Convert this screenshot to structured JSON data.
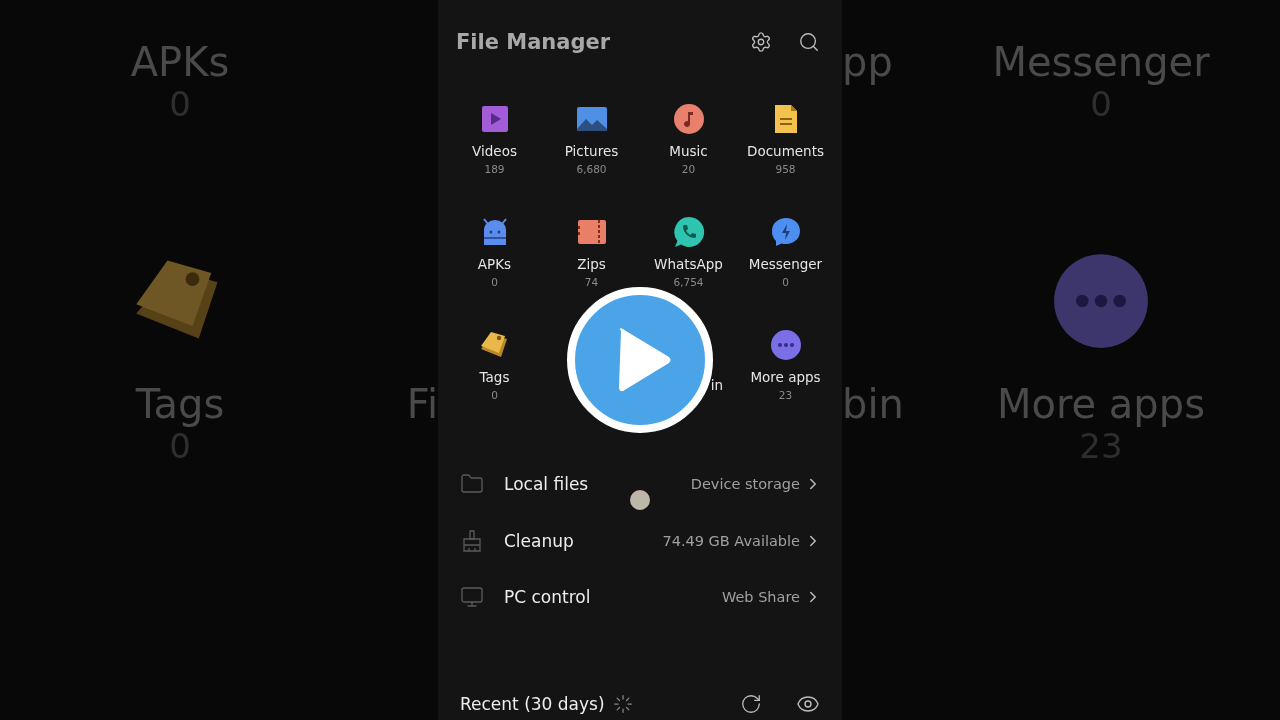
{
  "backdrop": {
    "left": {
      "column": [
        {
          "label": "APKs",
          "count": "0"
        },
        {
          "label": "Tags",
          "count": "0",
          "kind": "tag"
        }
      ],
      "edge_bottom": "Fi"
    },
    "right": {
      "edge_top": "pp",
      "edge_bottom": "bin",
      "column": [
        {
          "label": "Messenger",
          "count": "0"
        },
        {
          "label": "More apps",
          "count": "23",
          "kind": "more"
        }
      ]
    }
  },
  "header": {
    "title": "File Manager"
  },
  "categories": [
    {
      "kind": "video",
      "label": "Videos",
      "count": "189"
    },
    {
      "kind": "picture",
      "label": "Pictures",
      "count": "6,680"
    },
    {
      "kind": "music",
      "label": "Music",
      "count": "20"
    },
    {
      "kind": "document",
      "label": "Documents",
      "count": "958"
    },
    {
      "kind": "android",
      "label": "APKs",
      "count": "0"
    },
    {
      "kind": "zip",
      "label": "Zips",
      "count": "74"
    },
    {
      "kind": "chat-phone",
      "label": "WhatsApp",
      "count": "6,754"
    },
    {
      "kind": "chat-bolt",
      "label": "Messenger",
      "count": "0"
    },
    {
      "kind": "tag",
      "label": "Tags",
      "count": "0"
    },
    {
      "kind": "covered",
      "label": "in"
    },
    {
      "kind": "more",
      "label": "More apps",
      "count": "23"
    }
  ],
  "links": [
    {
      "kind": "folder",
      "label": "Local files",
      "value": "Device storage"
    },
    {
      "kind": "broom",
      "label": "Cleanup",
      "value": "74.49 GB Available"
    },
    {
      "kind": "monitor",
      "label": "PC control",
      "value": "Web Share"
    }
  ],
  "recent": {
    "title": "Recent (30 days)",
    "loading": true
  }
}
